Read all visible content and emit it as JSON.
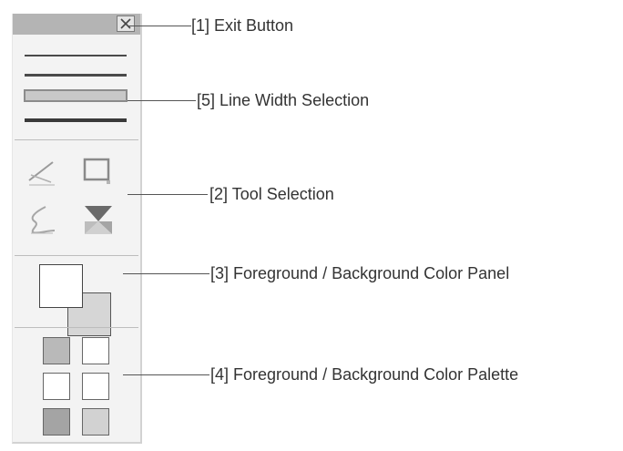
{
  "toolbox": {
    "exit_glyph": "×",
    "line_widths": [
      1,
      2,
      5,
      3
    ],
    "selected_line_width_index": 2,
    "tools": [
      "line-tool-icon",
      "rectangle-tool-icon",
      "freehand-tool-icon",
      "fill-tool-icon"
    ],
    "foreground_color": "#ffffff",
    "background_color": "#d6d6d6",
    "palette": [
      "#b9b9b9",
      "#ffffff",
      "#ffffff",
      "#ffffff",
      "#a4a4a4",
      "#d2d2d2"
    ]
  },
  "callouts": {
    "exit": "[1] Exit Button",
    "line_width": "[5] Line Width Selection",
    "tool": "[2] Tool Selection",
    "color_panel": "[3] Foreground / Background Color Panel",
    "color_palette": "[4] Foreground / Background Color Palette"
  }
}
